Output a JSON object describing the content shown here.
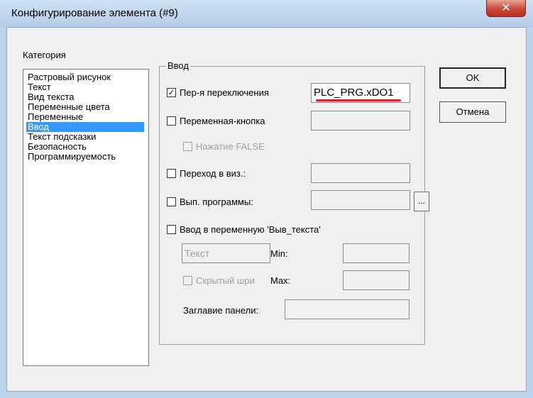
{
  "window": {
    "title": "Конфигурирование элемента (#9)",
    "close_glyph": "✕"
  },
  "category": {
    "label": "Категория",
    "items": [
      {
        "label": "Растровый рисунок",
        "selected": false
      },
      {
        "label": "Текст",
        "selected": false
      },
      {
        "label": "Вид текста",
        "selected": false
      },
      {
        "label": "Переменные цвета",
        "selected": false
      },
      {
        "label": "Переменные",
        "selected": false
      },
      {
        "label": "Ввод",
        "selected": true
      },
      {
        "label": "Текст подсказки",
        "selected": false
      },
      {
        "label": "Безопасность",
        "selected": false
      },
      {
        "label": "Программируемость",
        "selected": false
      }
    ]
  },
  "input_group": {
    "title": "Ввод",
    "toggle_var": {
      "label": "Пер-я переключения",
      "checked": true,
      "value": "PLC_PRG.xDO1"
    },
    "tap_var": {
      "label": "Переменная-кнопка",
      "checked": false,
      "value": ""
    },
    "tap_false": {
      "label": "Нажатие FALSE",
      "checked": false
    },
    "goto_vis": {
      "label": "Переход в виз.:",
      "checked": false,
      "value": ""
    },
    "exec_program": {
      "label": "Вып. программы:",
      "checked": false,
      "value": "",
      "browse_label": "..."
    },
    "text_input": {
      "label": "Ввод в переменную 'Выв_текста'",
      "checked": false
    },
    "text_type": {
      "value": "Текст"
    },
    "min": {
      "label": "Min:",
      "value": ""
    },
    "max": {
      "label": "Max:",
      "value": ""
    },
    "hidden_font": {
      "label": "Скрытый шри",
      "checked": false
    },
    "panel_title": {
      "label": "Заглавие панели:",
      "value": ""
    }
  },
  "buttons": {
    "ok": "OK",
    "cancel": "Отмена"
  },
  "accent": {
    "selection": "#3399ff",
    "annotation_underline": "#e02020"
  }
}
